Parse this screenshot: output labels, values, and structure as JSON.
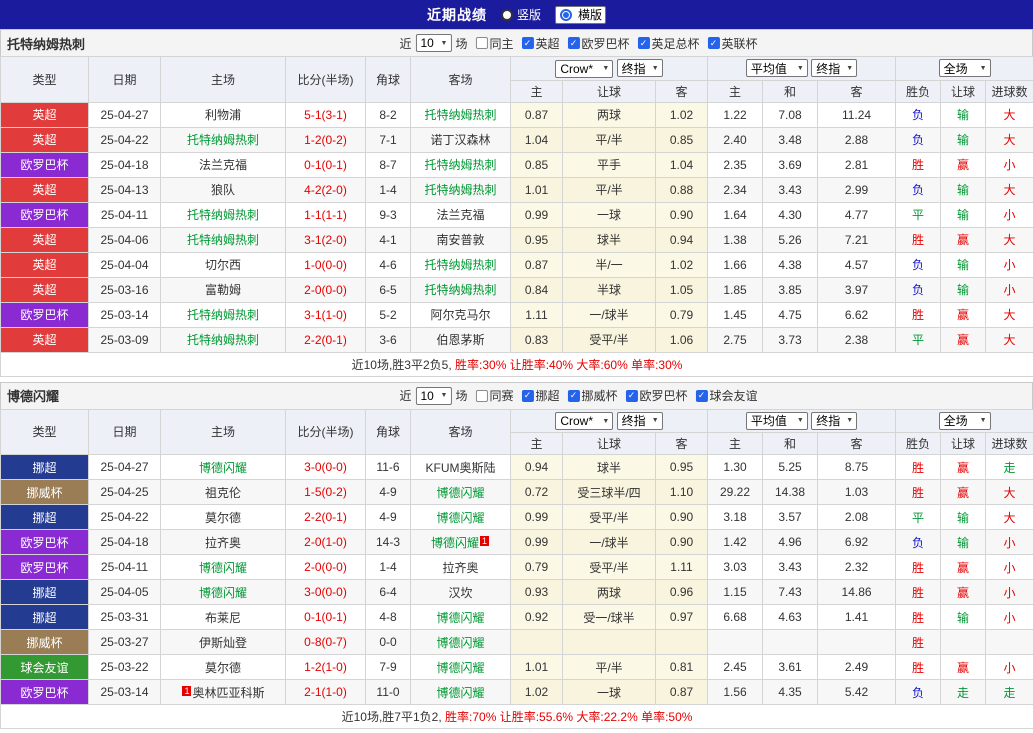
{
  "topbar": {
    "title": "近期战绩",
    "vertical": "竖版",
    "horizontal": "横版"
  },
  "filter": {
    "near": "近",
    "count": "10",
    "matches": "场"
  },
  "table_header": {
    "type": "类型",
    "date": "日期",
    "home": "主场",
    "score": "比分(半场)",
    "corners": "角球",
    "away": "客场",
    "odds_source": "Crow*",
    "final1": "终指",
    "avg": "平均值",
    "final2": "终指",
    "full": "全场",
    "sub": [
      "主",
      "让球",
      "客",
      "主",
      "和",
      "客",
      "胜负",
      "让球",
      "进球数"
    ]
  },
  "colors": {
    "topbar_bg": "#1b1b9e",
    "accent_blue": "#2563eb",
    "score_red": "#e60000",
    "focal_green": "#009933",
    "league_colors": {
      "英超": "#e23b3b",
      "欧罗巴杯": "#8a2ad2",
      "挪超": "#233c92",
      "挪威杯": "#9b7d55",
      "球会友谊": "#339933"
    },
    "result_colors": {
      "胜": "#e60000",
      "负": "#1414cc",
      "平": "#009933",
      "赢": "#e60000",
      "输": "#009933",
      "走": "#009933",
      "大": "#e60000",
      "小": "#e60000"
    }
  },
  "sections": [
    {
      "team": "托特纳姆热刺",
      "same_label": "同主",
      "leagues": [
        "英超",
        "欧罗巴杯",
        "英足总杯",
        "英联杯"
      ],
      "summary_prefix": "近10场,胜3平2负5,",
      "summary_stats": "胜率:30% 让胜率:40% 大率:60% 单率:30%",
      "rows": [
        {
          "league": "英超",
          "date": "25-04-27",
          "home": "利物浦",
          "home_focal": false,
          "score": "5-1(3-1)",
          "corners": "8-2",
          "away": "托特纳姆热刺",
          "away_focal": true,
          "odds": [
            "0.87",
            "两球",
            "1.02"
          ],
          "avg": [
            "1.22",
            "7.08",
            "11.24"
          ],
          "results": [
            "负",
            "输",
            "大"
          ]
        },
        {
          "league": "英超",
          "date": "25-04-22",
          "home": "托特纳姆热刺",
          "home_focal": true,
          "score": "1-2(0-2)",
          "corners": "7-1",
          "away": "诺丁汉森林",
          "away_focal": false,
          "odds": [
            "1.04",
            "平/半",
            "0.85"
          ],
          "avg": [
            "2.40",
            "3.48",
            "2.88"
          ],
          "results": [
            "负",
            "输",
            "大"
          ]
        },
        {
          "league": "欧罗巴杯",
          "date": "25-04-18",
          "home": "法兰克福",
          "home_focal": false,
          "score": "0-1(0-1)",
          "corners": "8-7",
          "away": "托特纳姆热刺",
          "away_focal": true,
          "odds": [
            "0.85",
            "平手",
            "1.04"
          ],
          "avg": [
            "2.35",
            "3.69",
            "2.81"
          ],
          "results": [
            "胜",
            "赢",
            "小"
          ]
        },
        {
          "league": "英超",
          "date": "25-04-13",
          "home": "狼队",
          "home_focal": false,
          "score": "4-2(2-0)",
          "corners": "1-4",
          "away": "托特纳姆热刺",
          "away_focal": true,
          "odds": [
            "1.01",
            "平/半",
            "0.88"
          ],
          "avg": [
            "2.34",
            "3.43",
            "2.99"
          ],
          "results": [
            "负",
            "输",
            "大"
          ]
        },
        {
          "league": "欧罗巴杯",
          "date": "25-04-11",
          "home": "托特纳姆热刺",
          "home_focal": true,
          "score": "1-1(1-1)",
          "corners": "9-3",
          "away": "法兰克福",
          "away_focal": false,
          "odds": [
            "0.99",
            "一球",
            "0.90"
          ],
          "avg": [
            "1.64",
            "4.30",
            "4.77"
          ],
          "results": [
            "平",
            "输",
            "小"
          ]
        },
        {
          "league": "英超",
          "date": "25-04-06",
          "home": "托特纳姆热刺",
          "home_focal": true,
          "score": "3-1(2-0)",
          "corners": "4-1",
          "away": "南安普敦",
          "away_focal": false,
          "odds": [
            "0.95",
            "球半",
            "0.94"
          ],
          "avg": [
            "1.38",
            "5.26",
            "7.21"
          ],
          "results": [
            "胜",
            "赢",
            "大"
          ]
        },
        {
          "league": "英超",
          "date": "25-04-04",
          "home": "切尔西",
          "home_focal": false,
          "score": "1-0(0-0)",
          "corners": "4-6",
          "away": "托特纳姆热刺",
          "away_focal": true,
          "odds": [
            "0.87",
            "半/一",
            "1.02"
          ],
          "avg": [
            "1.66",
            "4.38",
            "4.57"
          ],
          "results": [
            "负",
            "输",
            "小"
          ]
        },
        {
          "league": "英超",
          "date": "25-03-16",
          "home": "富勒姆",
          "home_focal": false,
          "score": "2-0(0-0)",
          "corners": "6-5",
          "away": "托特纳姆热刺",
          "away_focal": true,
          "odds": [
            "0.84",
            "半球",
            "1.05"
          ],
          "avg": [
            "1.85",
            "3.85",
            "3.97"
          ],
          "results": [
            "负",
            "输",
            "小"
          ]
        },
        {
          "league": "欧罗巴杯",
          "date": "25-03-14",
          "home": "托特纳姆热刺",
          "home_focal": true,
          "score": "3-1(1-0)",
          "corners": "5-2",
          "away": "阿尔克马尔",
          "away_focal": false,
          "odds": [
            "1.11",
            "一/球半",
            "0.79"
          ],
          "avg": [
            "1.45",
            "4.75",
            "6.62"
          ],
          "results": [
            "胜",
            "赢",
            "大"
          ]
        },
        {
          "league": "英超",
          "date": "25-03-09",
          "home": "托特纳姆热刺",
          "home_focal": true,
          "score": "2-2(0-1)",
          "corners": "3-6",
          "away": "伯恩茅斯",
          "away_focal": false,
          "odds": [
            "0.83",
            "受平/半",
            "1.06"
          ],
          "avg": [
            "2.75",
            "3.73",
            "2.38"
          ],
          "results": [
            "平",
            "赢",
            "大"
          ]
        }
      ]
    },
    {
      "team": "博德闪耀",
      "same_label": "同赛",
      "leagues": [
        "挪超",
        "挪威杯",
        "欧罗巴杯",
        "球会友谊"
      ],
      "summary_prefix": "近10场,胜7平1负2,",
      "summary_stats": "胜率:70% 让胜率:55.6% 大率:22.2% 单率:50%",
      "rows": [
        {
          "league": "挪超",
          "date": "25-04-27",
          "home": "博德闪耀",
          "home_focal": true,
          "score": "3-0(0-0)",
          "corners": "11-6",
          "away": "KFUM奥斯陆",
          "away_focal": false,
          "odds": [
            "0.94",
            "球半",
            "0.95"
          ],
          "avg": [
            "1.30",
            "5.25",
            "8.75"
          ],
          "results": [
            "胜",
            "赢",
            "走"
          ]
        },
        {
          "league": "挪威杯",
          "date": "25-04-25",
          "home": "祖克伦",
          "home_focal": false,
          "score": "1-5(0-2)",
          "corners": "4-9",
          "away": "博德闪耀",
          "away_focal": true,
          "odds": [
            "0.72",
            "受三球半/四",
            "1.10"
          ],
          "avg": [
            "29.22",
            "14.38",
            "1.03"
          ],
          "results": [
            "胜",
            "赢",
            "大"
          ]
        },
        {
          "league": "挪超",
          "date": "25-04-22",
          "home": "莫尔德",
          "home_focal": false,
          "score": "2-2(0-1)",
          "corners": "4-9",
          "away": "博德闪耀",
          "away_focal": true,
          "odds": [
            "0.99",
            "受平/半",
            "0.90"
          ],
          "avg": [
            "3.18",
            "3.57",
            "2.08"
          ],
          "results": [
            "平",
            "输",
            "大"
          ]
        },
        {
          "league": "欧罗巴杯",
          "date": "25-04-18",
          "home": "拉齐奥",
          "home_focal": false,
          "score": "2-0(1-0)",
          "corners": "14-3",
          "away": "博德闪耀",
          "away_focal": true,
          "away_card": "1",
          "odds": [
            "0.99",
            "一/球半",
            "0.90"
          ],
          "avg": [
            "1.42",
            "4.96",
            "6.92"
          ],
          "results": [
            "负",
            "输",
            "小"
          ]
        },
        {
          "league": "欧罗巴杯",
          "date": "25-04-11",
          "home": "博德闪耀",
          "home_focal": true,
          "score": "2-0(0-0)",
          "corners": "1-4",
          "away": "拉齐奥",
          "away_focal": false,
          "odds": [
            "0.79",
            "受平/半",
            "1.11"
          ],
          "avg": [
            "3.03",
            "3.43",
            "2.32"
          ],
          "results": [
            "胜",
            "赢",
            "小"
          ]
        },
        {
          "league": "挪超",
          "date": "25-04-05",
          "home": "博德闪耀",
          "home_focal": true,
          "score": "3-0(0-0)",
          "corners": "6-4",
          "away": "汉坎",
          "away_focal": false,
          "odds": [
            "0.93",
            "两球",
            "0.96"
          ],
          "avg": [
            "1.15",
            "7.43",
            "14.86"
          ],
          "results": [
            "胜",
            "赢",
            "小"
          ]
        },
        {
          "league": "挪超",
          "date": "25-03-31",
          "home": "布莱尼",
          "home_focal": false,
          "score": "0-1(0-1)",
          "corners": "4-8",
          "away": "博德闪耀",
          "away_focal": true,
          "odds": [
            "0.92",
            "受一/球半",
            "0.97"
          ],
          "avg": [
            "6.68",
            "4.63",
            "1.41"
          ],
          "results": [
            "胜",
            "输",
            "小"
          ]
        },
        {
          "league": "挪威杯",
          "date": "25-03-27",
          "home": "伊斯灿登",
          "home_focal": false,
          "score": "0-8(0-7)",
          "corners": "0-0",
          "away": "博德闪耀",
          "away_focal": true,
          "odds": [
            "",
            "",
            ""
          ],
          "avg": [
            "",
            "",
            ""
          ],
          "results": [
            "胜",
            "",
            ""
          ]
        },
        {
          "league": "球会友谊",
          "date": "25-03-22",
          "home": "莫尔德",
          "home_focal": false,
          "score": "1-2(1-0)",
          "corners": "7-9",
          "away": "博德闪耀",
          "away_focal": true,
          "odds": [
            "1.01",
            "平/半",
            "0.81"
          ],
          "avg": [
            "2.45",
            "3.61",
            "2.49"
          ],
          "results": [
            "胜",
            "赢",
            "小"
          ]
        },
        {
          "league": "欧罗巴杯",
          "date": "25-03-14",
          "home": "奥林匹亚科斯",
          "home_focal": false,
          "home_card": "1",
          "score": "2-1(1-0)",
          "corners": "11-0",
          "away": "博德闪耀",
          "away_focal": true,
          "odds": [
            "1.02",
            "一球",
            "0.87"
          ],
          "avg": [
            "1.56",
            "4.35",
            "5.42"
          ],
          "results": [
            "负",
            "走",
            "走"
          ]
        }
      ]
    }
  ]
}
